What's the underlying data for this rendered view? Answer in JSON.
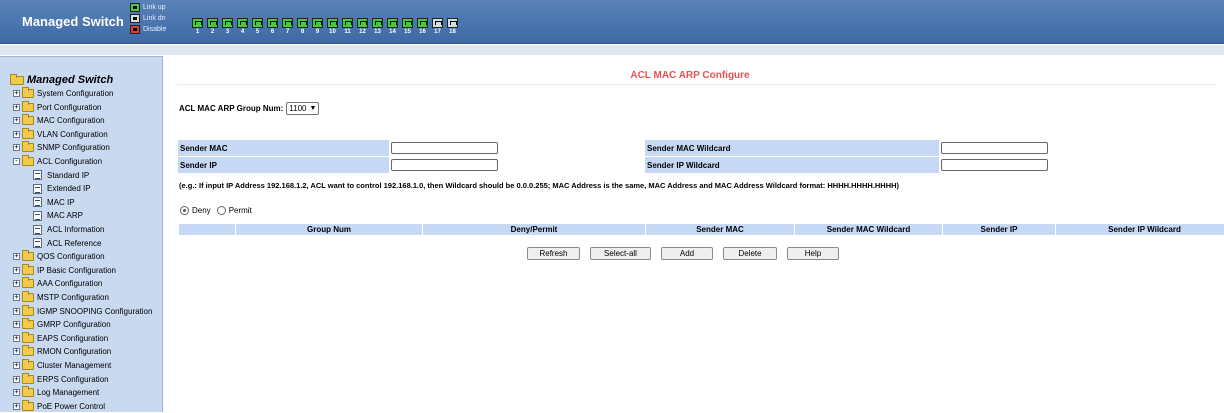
{
  "header": {
    "brand": "Managed Switch",
    "legend": [
      {
        "label": "Link up",
        "color": "#46c93a"
      },
      {
        "label": "Link dn",
        "color": "#d8dbe0"
      },
      {
        "label": "Disable",
        "color": "#e03b2f"
      }
    ],
    "ports": [
      {
        "num": "1",
        "state": "up"
      },
      {
        "num": "2",
        "state": "up"
      },
      {
        "num": "3",
        "state": "up"
      },
      {
        "num": "4",
        "state": "up"
      },
      {
        "num": "5",
        "state": "up"
      },
      {
        "num": "6",
        "state": "up"
      },
      {
        "num": "7",
        "state": "up"
      },
      {
        "num": "8",
        "state": "up"
      },
      {
        "num": "9",
        "state": "up"
      },
      {
        "num": "10",
        "state": "up"
      },
      {
        "num": "11",
        "state": "up"
      },
      {
        "num": "12",
        "state": "up"
      },
      {
        "num": "13",
        "state": "up"
      },
      {
        "num": "14",
        "state": "up"
      },
      {
        "num": "15",
        "state": "up"
      },
      {
        "num": "16",
        "state": "up"
      },
      {
        "num": "17",
        "state": "down"
      },
      {
        "num": "18",
        "state": "down"
      }
    ]
  },
  "sidebar": {
    "root": "Managed Switch",
    "items": [
      {
        "label": "System Configuration",
        "expander": "+"
      },
      {
        "label": "Port Configuration",
        "expander": "+"
      },
      {
        "label": "MAC Configuration",
        "expander": "+"
      },
      {
        "label": "VLAN Configuration",
        "expander": "+"
      },
      {
        "label": "SNMP Configuration",
        "expander": "+"
      },
      {
        "label": "ACL Configuration",
        "expander": "-"
      },
      {
        "label": "QOS Configuration",
        "expander": "+"
      },
      {
        "label": "IP Basic Configuration",
        "expander": "+"
      },
      {
        "label": "AAA Configuration",
        "expander": "+"
      },
      {
        "label": "MSTP Configuration",
        "expander": "+"
      },
      {
        "label": "IGMP SNOOPING Configuration",
        "expander": "+"
      },
      {
        "label": "GMRP Configuration",
        "expander": "+"
      },
      {
        "label": "EAPS Configuration",
        "expander": "+"
      },
      {
        "label": "RMON Configuration",
        "expander": "+"
      },
      {
        "label": "Cluster Management",
        "expander": "+"
      },
      {
        "label": "ERPS Configuration",
        "expander": "+"
      },
      {
        "label": "Log Management",
        "expander": "+"
      },
      {
        "label": "PoE Power Control",
        "expander": "+"
      }
    ],
    "acl_children": [
      "Standard IP",
      "Extended IP",
      "MAC IP",
      "MAC ARP",
      "ACL Information",
      "ACL Reference"
    ]
  },
  "main": {
    "title": "ACL MAC ARP Configure",
    "group_num_label": "ACL MAC ARP Group Num:",
    "group_num_value": "1100",
    "sender_mac_label": "Sender MAC",
    "sender_mac_value": "",
    "sender_mac_wildcard_label": "Sender MAC Wildcard",
    "sender_mac_wildcard_value": "",
    "sender_ip_label": "Sender IP",
    "sender_ip_value": "",
    "sender_ip_wildcard_label": "Sender IP Wildcard",
    "sender_ip_wildcard_value": "",
    "example": "(e.g.: If input IP Address 192.168.1.2, ACL want to control 192.168.1.0, then Wildcard should be 0.0.0.255; MAC Address is the same, MAC Address and MAC Address Wildcard format: HHHH.HHHH.HHHH)",
    "deny_label": "Deny",
    "permit_label": "Permit",
    "selected_action": "Deny",
    "table_columns": [
      "",
      "Group Num",
      "Deny/Permit",
      "Sender MAC",
      "Sender MAC Wildcard",
      "Sender IP",
      "Sender IP Wildcard"
    ],
    "buttons": [
      "Refresh",
      "Select-all",
      "Add",
      "Delete",
      "Help"
    ]
  }
}
